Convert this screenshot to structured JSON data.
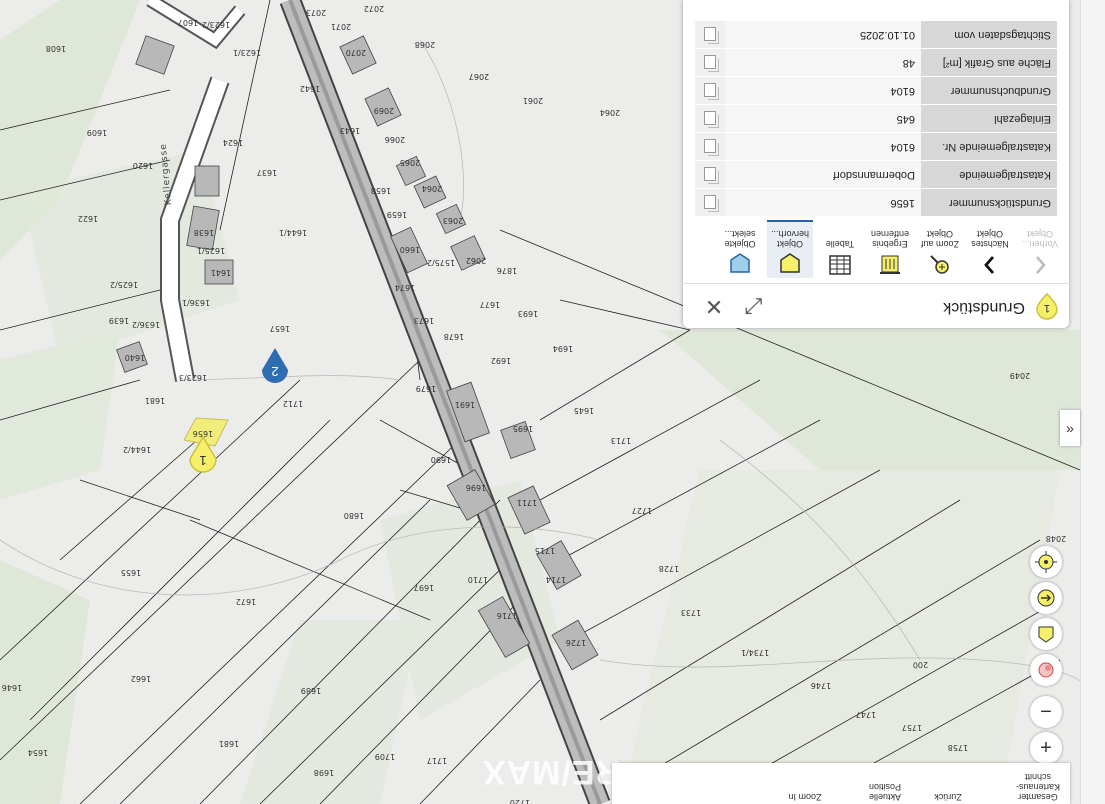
{
  "map": {
    "parcel_numbers": [
      "1608",
      "1607",
      "1623/2",
      "2073",
      "2071",
      "2072",
      "2070",
      "2068",
      "2067",
      "2061",
      "2064",
      "1623/1",
      "1642",
      "2069",
      "1643",
      "1609",
      "1624",
      "2066",
      "1620",
      "1637",
      "2065",
      "1658",
      "2064",
      "1622",
      "1638",
      "1659",
      "2063",
      "1644/1",
      "1625/1",
      "1660",
      "1575/2",
      "2062",
      "1876",
      "1641",
      "1625/2",
      "1674",
      "1677",
      "1636/1",
      "1673",
      "1693",
      "1639",
      "1636/2",
      "1657",
      "1678",
      "1694",
      "1640",
      "1623/3",
      "1692",
      "2049",
      "1679",
      "1691",
      "1712",
      "1645",
      "1681",
      "1695",
      "1713",
      "1644/2",
      "1656",
      "1690",
      "1696",
      "1711",
      "1727",
      "1680",
      "1715",
      "1714",
      "1728",
      "1655",
      "1697",
      "1710",
      "1672",
      "1716",
      "1733",
      "1726",
      "1734/1",
      "1646",
      "1662",
      "1689",
      "1746",
      "1747",
      "1757",
      "1681",
      "1758",
      "1654",
      "1698",
      "1709",
      "1717",
      "2048",
      "1720"
    ],
    "street_name": "Kellergasse",
    "road_label": "200",
    "marker_1_label": "1",
    "marker_2_label": "2",
    "watermark": "RE/MAX",
    "colors": {
      "accent": "#2a63a5",
      "parcel_highlight": "#f2ec7a",
      "marker_blue": "#2f6db3",
      "marker_yellow": "#f5ef6a",
      "vegetation": "#dfe8d8",
      "road": "#b9b9b9"
    }
  },
  "panel": {
    "badge": "1",
    "title": "Grundstück",
    "tools": [
      {
        "label": "Vorheri... Objekt",
        "icon": "chevron-left-icon",
        "disabled": true
      },
      {
        "label": "Nächstes Objekt",
        "icon": "chevron-right-icon",
        "disabled": false
      },
      {
        "label": "Zoom auf Objekt",
        "icon": "zoom-to-object-icon",
        "disabled": false
      },
      {
        "label": "Ergebnis entfernen",
        "icon": "remove-result-icon",
        "disabled": false
      },
      {
        "label": "Tabelle",
        "icon": "table-icon",
        "disabled": false
      },
      {
        "label": "Objekt hervorh...",
        "icon": "highlight-object-icon",
        "disabled": false
      },
      {
        "label": "Objekte selekt...",
        "icon": "select-objects-icon",
        "disabled": false
      }
    ],
    "rows": [
      {
        "label": "Grundstücksnummer",
        "value": "1656"
      },
      {
        "label": "Katastralgemeinde",
        "value": "Dobermannsdorf"
      },
      {
        "label": "Katastralgemeinde Nr.",
        "value": "6104"
      },
      {
        "label": "Einlagezahl",
        "value": "645"
      },
      {
        "label": "Grundbuchsnummer",
        "value": "6104"
      },
      {
        "label": "Fläche aus Grafik [m²]",
        "value": "48"
      },
      {
        "label": "Stichtagsdaten vom",
        "value": "01.10.2025"
      }
    ]
  },
  "bottombar": {
    "items": [
      "Gesamter Kartenaus-schnitt",
      "Zurück",
      "Aktuelle Position",
      "Zoom In"
    ]
  },
  "controls": {
    "zoom_in": "+",
    "zoom_out": "−",
    "expand": "»"
  }
}
